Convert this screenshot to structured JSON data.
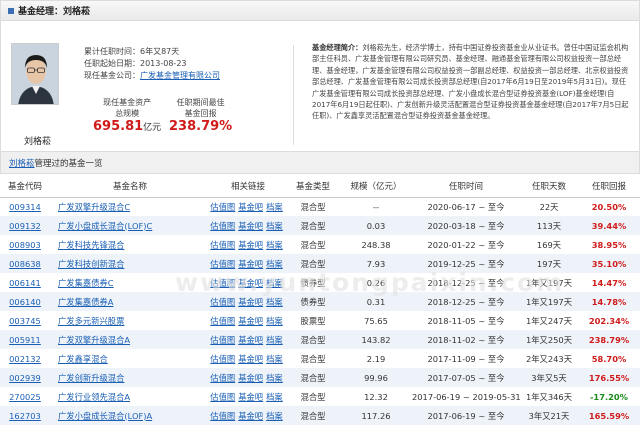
{
  "header": {
    "title": "基金经理：刘格菘"
  },
  "profile": {
    "name": "刘格菘",
    "rows": [
      {
        "label": "累计任职时间：",
        "value": "6年又87天"
      },
      {
        "label": "任职起始日期：",
        "value": "2013-08-23"
      },
      {
        "label": "现任基金公司：",
        "value": "广发基金管理有限公司"
      }
    ],
    "assets": {
      "label1": "现任基金资产",
      "label2": "总规模",
      "value": "695.81",
      "unit": "亿元"
    },
    "best": {
      "label1": "任职期间最佳",
      "label2": "基金回报",
      "value": "238.79%"
    },
    "bio_label": "基金经理简介：",
    "bio": "刘格菘先生，经济学博士，持有中国证券投资基金业从业证书。曾任中国证监会机构部主任科员、广发基金管理有限公司研究员、基金经理、融通基金管理有限公司权益投资一部总经理、基金经理，广发基金管理有限公司权益投资一部副总经理、权益投资一部总经理、北京权益投资部总经理、广发基金管理有限公司成长投资部总经理(自2017年6月19日至2019年5月31日)。现任广发基金管理有限公司成长投资部总经理、广发小盘成长混合型证券投资基金(LOF)基金经理(自2017年6月19日起任职)、广发创新升级灵活配置混合型证券投资基金基金经理(自2017年7月5日起任职)、广发鑫享灵活配置混合型证券投资基金基金经理。"
  },
  "section": {
    "name": "刘格菘",
    "text": "管理过的基金一览"
  },
  "watermark": "www.yuntongpaixin.com",
  "table": {
    "headers": [
      "基金代码",
      "基金名称",
      "相关链接",
      "基金类型",
      "规模（亿元）",
      "任职时间",
      "任职天数",
      "任职回报"
    ],
    "link_labels": [
      "估值图",
      "基金吧",
      "档案"
    ],
    "rows": [
      {
        "code": "009314",
        "name": "广发双擎升级混合C",
        "type": "混合型",
        "size": "--",
        "period": "2020-06-17 ~ 至今",
        "days": "22天",
        "ret": "20.50%",
        "neg": false
      },
      {
        "code": "009132",
        "name": "广发小盘成长混合(LOF)C",
        "type": "混合型",
        "size": "0.03",
        "period": "2020-03-18 ~ 至今",
        "days": "113天",
        "ret": "39.44%",
        "neg": false
      },
      {
        "code": "008903",
        "name": "广发科技先锋混合",
        "type": "混合型",
        "size": "248.38",
        "period": "2020-01-22 ~ 至今",
        "days": "169天",
        "ret": "38.95%",
        "neg": false
      },
      {
        "code": "008638",
        "name": "广发科技创新混合",
        "type": "混合型",
        "size": "7.93",
        "period": "2019-12-25 ~ 至今",
        "days": "197天",
        "ret": "35.10%",
        "neg": false
      },
      {
        "code": "006141",
        "name": "广发集嘉债券C",
        "type": "债券型",
        "size": "0.26",
        "period": "2018-12-25 ~ 至今",
        "days": "1年又197天",
        "ret": "14.47%",
        "neg": false
      },
      {
        "code": "006140",
        "name": "广发集嘉债券A",
        "type": "债券型",
        "size": "0.31",
        "period": "2018-12-25 ~ 至今",
        "days": "1年又197天",
        "ret": "14.78%",
        "neg": false
      },
      {
        "code": "003745",
        "name": "广发多元新兴股票",
        "type": "股票型",
        "size": "75.65",
        "period": "2018-11-05 ~ 至今",
        "days": "1年又247天",
        "ret": "202.34%",
        "neg": false
      },
      {
        "code": "005911",
        "name": "广发双擎升级混合A",
        "type": "混合型",
        "size": "143.82",
        "period": "2018-11-02 ~ 至今",
        "days": "1年又250天",
        "ret": "238.79%",
        "neg": false
      },
      {
        "code": "002132",
        "name": "广发鑫享混合",
        "type": "混合型",
        "size": "2.19",
        "period": "2017-11-09 ~ 至今",
        "days": "2年又243天",
        "ret": "58.70%",
        "neg": false
      },
      {
        "code": "002939",
        "name": "广发创新升级混合",
        "type": "混合型",
        "size": "99.96",
        "period": "2017-07-05 ~ 至今",
        "days": "3年又5天",
        "ret": "176.55%",
        "neg": false
      },
      {
        "code": "270025",
        "name": "广发行业领先混合A",
        "type": "混合型",
        "size": "12.32",
        "period": "2017-06-19 ~ 2019-05-31",
        "days": "1年又346天",
        "ret": "-17.20%",
        "neg": true
      },
      {
        "code": "162703",
        "name": "广发小盘成长混合(LOF)A",
        "type": "混合型",
        "size": "117.26",
        "period": "2017-06-19 ~ 至今",
        "days": "3年又21天",
        "ret": "165.59%",
        "neg": false
      }
    ]
  }
}
